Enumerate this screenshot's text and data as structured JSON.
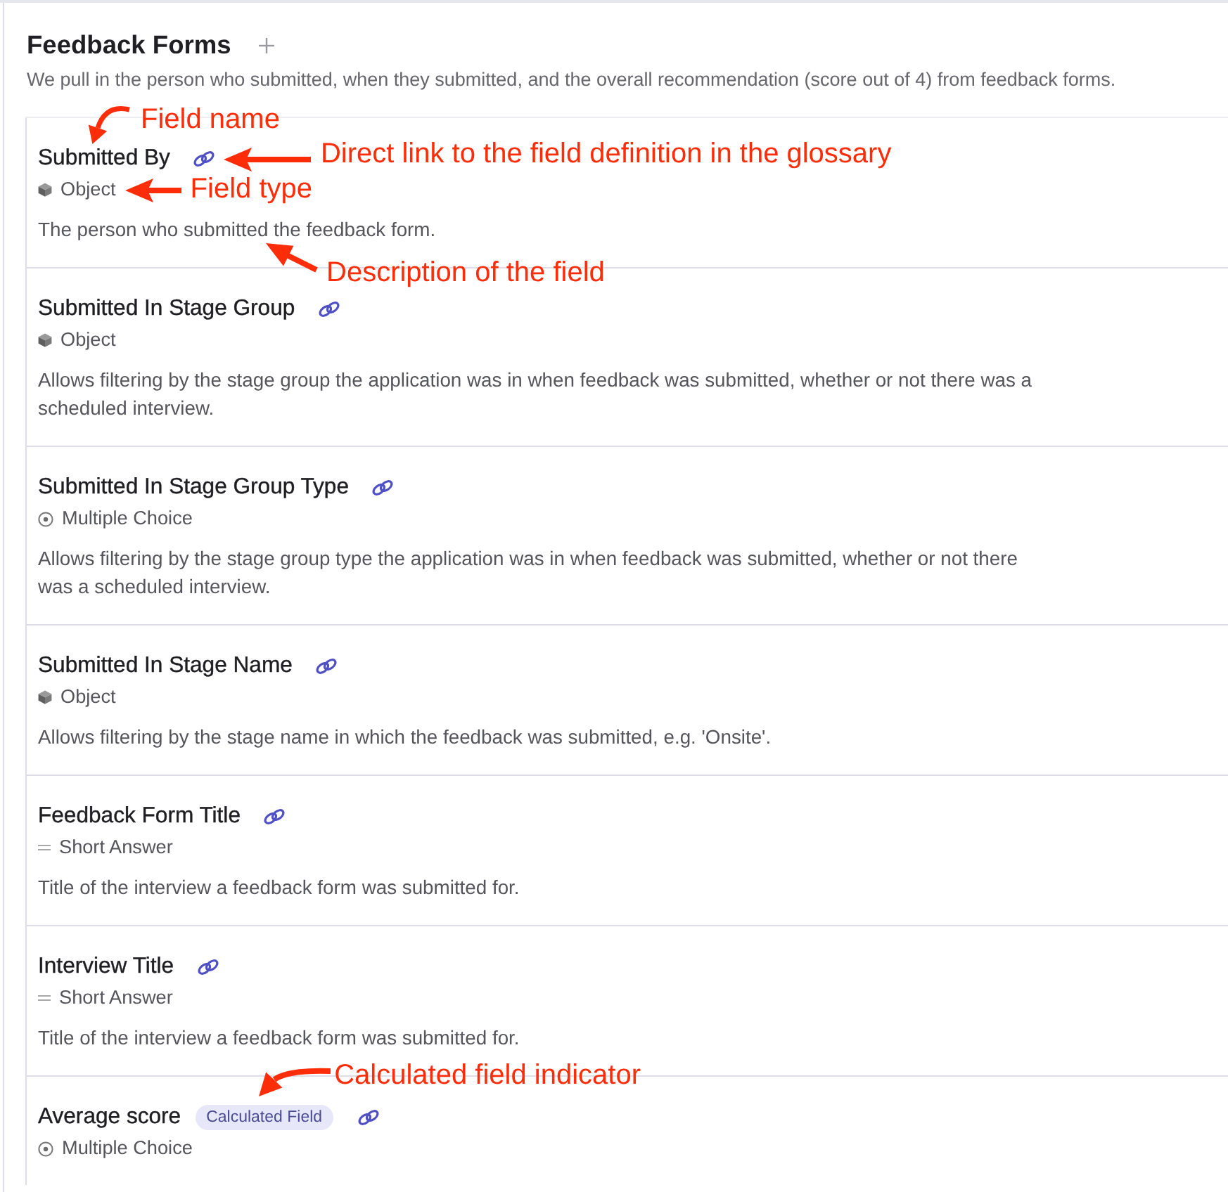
{
  "header": {
    "title": "Feedback Forms",
    "description": "We pull in the person who submitted, when they submitted, and the overall recommendation (score out of 4) from feedback forms."
  },
  "fields": [
    {
      "name": "Submitted By",
      "type": {
        "kind": "object",
        "label": "Object"
      },
      "description": "The person who submitted the feedback form.",
      "annotations": [
        {
          "kind": "name",
          "text": "Field name"
        },
        {
          "kind": "link",
          "text": "Direct link to the field definition in the glossary"
        },
        {
          "kind": "type",
          "text": "Field type"
        },
        {
          "kind": "description",
          "text": "Description of the field"
        }
      ]
    },
    {
      "name": "Submitted In Stage Group",
      "type": {
        "kind": "object",
        "label": "Object"
      },
      "description": "Allows filtering by the stage group the application was in when feedback was submitted, whether or not there was a scheduled interview."
    },
    {
      "name": "Submitted In Stage Group Type",
      "type": {
        "kind": "multiple_choice",
        "label": "Multiple Choice"
      },
      "description": "Allows filtering by the stage group type the application was in when feedback was submitted, whether or not there was a scheduled interview."
    },
    {
      "name": "Submitted In Stage Name",
      "type": {
        "kind": "object",
        "label": "Object"
      },
      "description": "Allows filtering by the stage name in which the feedback was submitted, e.g. 'Onsite'."
    },
    {
      "name": "Feedback Form Title",
      "type": {
        "kind": "short_answer",
        "label": "Short Answer"
      },
      "description": "Title of the interview a feedback form was submitted for."
    },
    {
      "name": "Interview Title",
      "type": {
        "kind": "short_answer",
        "label": "Short Answer"
      },
      "description": "Title of the interview a feedback form was submitted for."
    },
    {
      "name": "Average score",
      "badge": "Calculated Field",
      "type": {
        "kind": "multiple_choice",
        "label": "Multiple Choice"
      },
      "annotations": [
        {
          "kind": "badge",
          "text": "Calculated field indicator"
        }
      ]
    }
  ]
}
